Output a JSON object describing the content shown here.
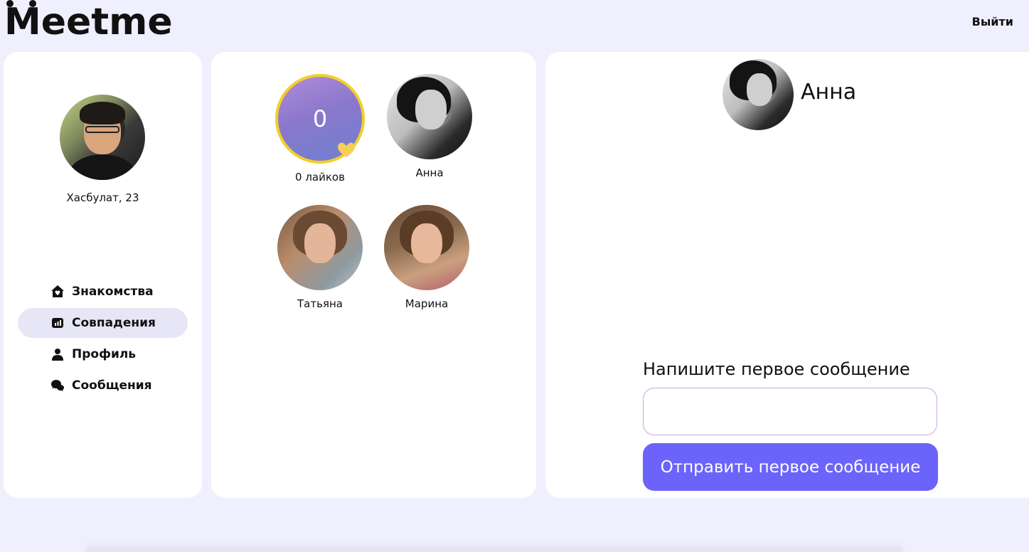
{
  "header": {
    "logo_text": "eetme",
    "logo_m": "M",
    "logout_label": "Выйти"
  },
  "user": {
    "name_age": "Хасбулат, 23"
  },
  "nav": {
    "items": [
      {
        "label": "Знакомства",
        "icon": "home-heart-icon",
        "active": false
      },
      {
        "label": "Совпадения",
        "icon": "chart-icon",
        "active": true
      },
      {
        "label": "Профиль",
        "icon": "user-icon",
        "active": false
      },
      {
        "label": "Сообщения",
        "icon": "chat-icon",
        "active": false
      }
    ]
  },
  "matches": {
    "likes": {
      "count": "0",
      "label": "0 лайков"
    },
    "people": [
      {
        "name": "Анна"
      },
      {
        "name": "Татьяна"
      },
      {
        "name": "Марина"
      }
    ]
  },
  "chat": {
    "partner_name": "Анна",
    "first_message_title": "Напишите первое сообщение",
    "input_value": "",
    "input_placeholder": "",
    "send_label": "Отправить первое сообщение"
  },
  "colors": {
    "background": "#efeffd",
    "panel": "#ffffff",
    "accent": "#6c63fa",
    "nav_active": "#e7e6f7",
    "likes_ring": "#f2cf2a",
    "heart": "#f6cf58"
  }
}
